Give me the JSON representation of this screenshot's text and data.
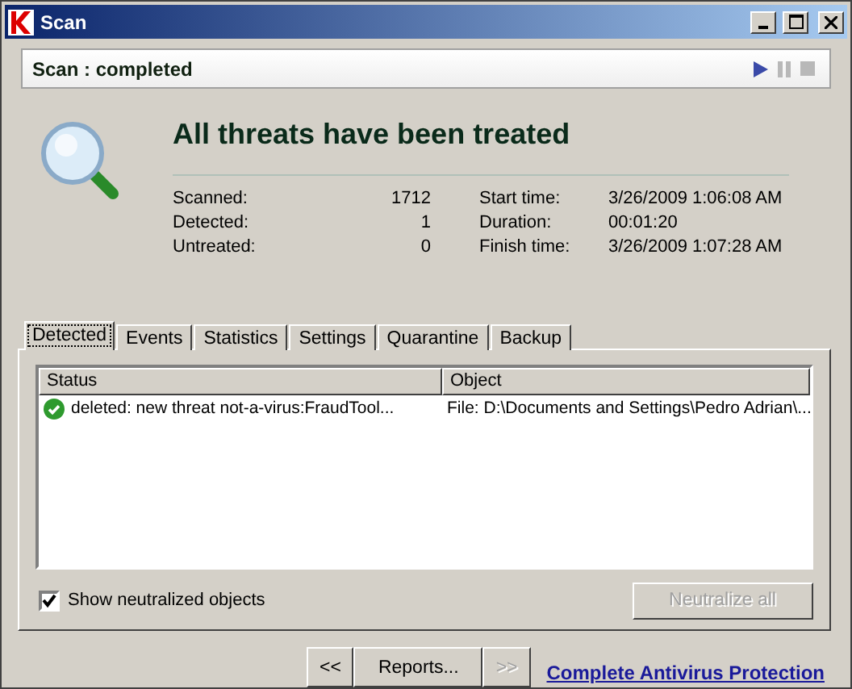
{
  "window": {
    "title": "Scan"
  },
  "status": {
    "text": "Scan : completed",
    "controls": [
      {
        "kind": "play",
        "disabled": false
      },
      {
        "kind": "pause",
        "disabled": true
      },
      {
        "kind": "stop",
        "disabled": true
      }
    ]
  },
  "heading": "All threats have been treated",
  "stats_left": [
    {
      "label": "Scanned:",
      "value": "1712"
    },
    {
      "label": "Detected:",
      "value": "1"
    },
    {
      "label": "Untreated:",
      "value": "0"
    }
  ],
  "stats_right": [
    {
      "label": "Start time:",
      "value": "3/26/2009 1:06:08 AM"
    },
    {
      "label": "Duration:",
      "value": "00:01:20"
    },
    {
      "label": "Finish time:",
      "value": "3/26/2009 1:07:28 AM"
    }
  ],
  "tabs": [
    {
      "label": "Detected",
      "selected": true
    },
    {
      "label": "Events",
      "selected": false
    },
    {
      "label": "Statistics",
      "selected": false
    },
    {
      "label": "Settings",
      "selected": false
    },
    {
      "label": "Quarantine",
      "selected": false
    },
    {
      "label": "Backup",
      "selected": false
    }
  ],
  "table": {
    "columns": [
      "Status",
      "Object"
    ],
    "rows": [
      {
        "kind": "ok",
        "status": "deleted: new threat not-a-virus:FraudTool...",
        "object": "File: D:\\Documents and Settings\\Pedro Adrian\\..."
      }
    ]
  },
  "show_neutralized": {
    "label": "Show neutralized objects",
    "checked": true
  },
  "neutralize_button": {
    "label": "Neutralize all",
    "disabled": true
  },
  "nav_buttons": [
    {
      "label": "<<",
      "disabled": false
    },
    {
      "label": "Reports...",
      "disabled": false
    },
    {
      "label": ">>",
      "disabled": true
    }
  ],
  "link": "Complete Antivirus Protection"
}
